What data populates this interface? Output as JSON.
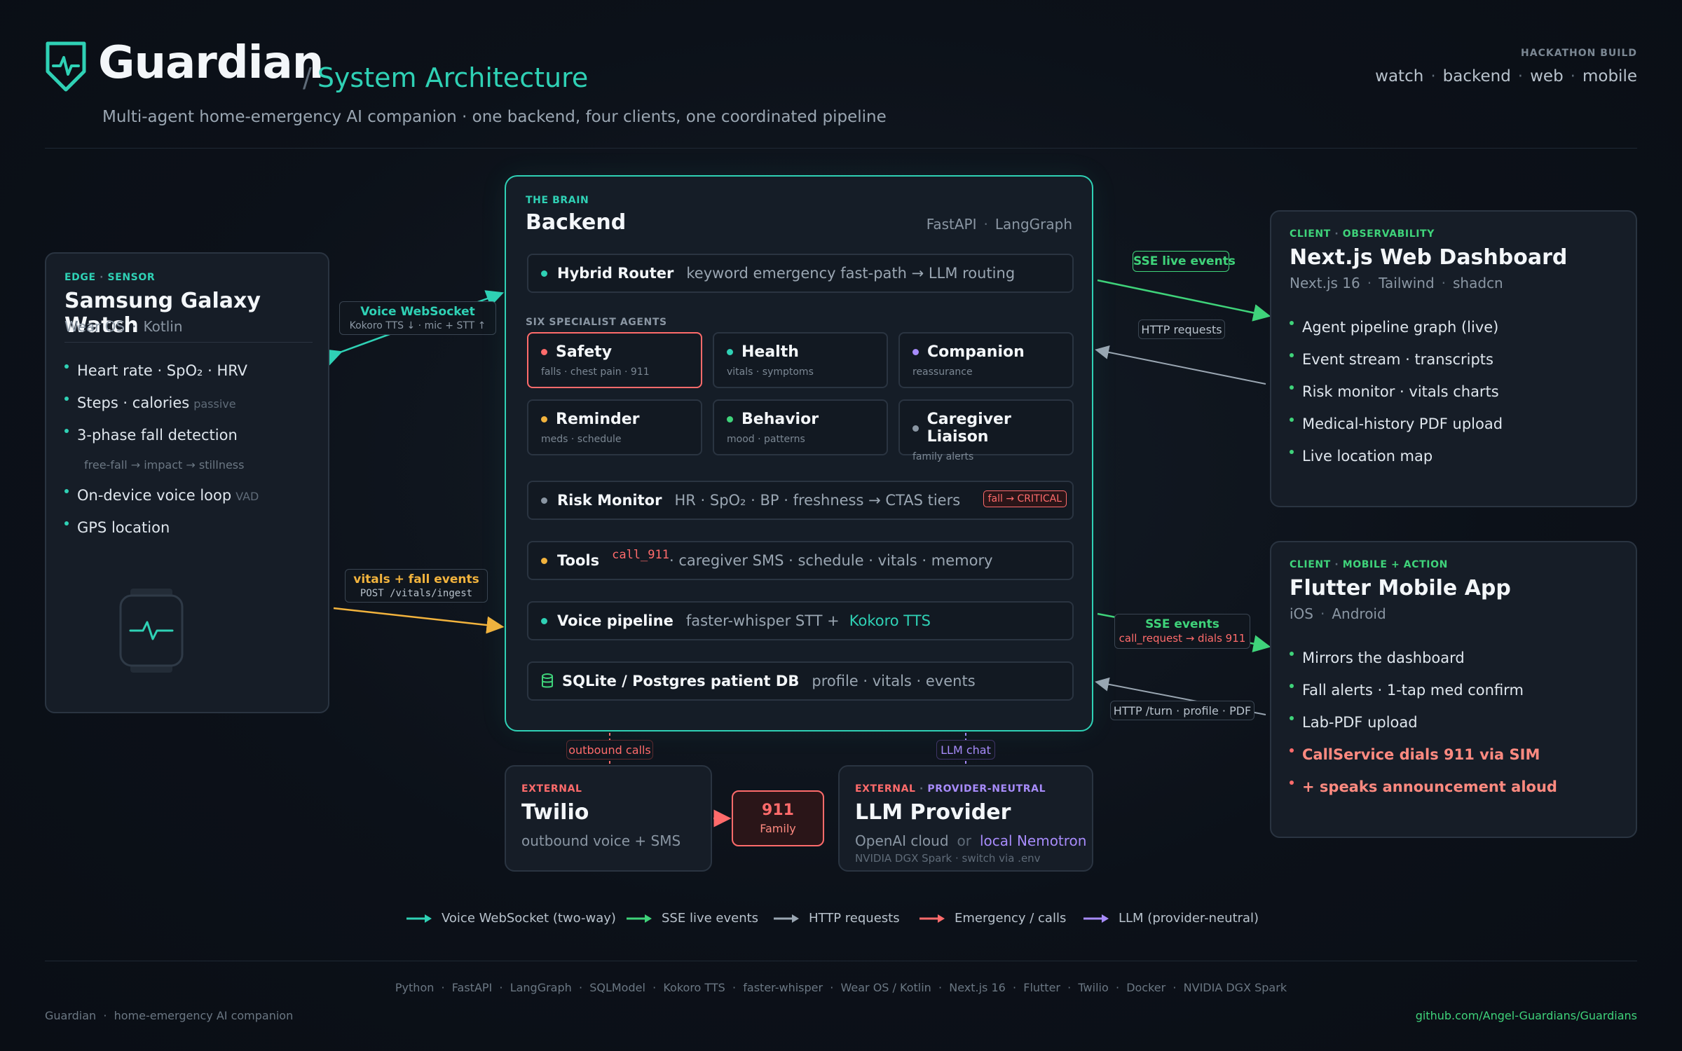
{
  "header": {
    "title": "Guardian",
    "slash": "/",
    "subtitle": "System Architecture",
    "tagline": "Multi-agent home-emergency AI companion  ·  one backend, four clients, one coordinated pipeline",
    "build_label": "HACKATHON BUILD",
    "targets": [
      "watch",
      "backend",
      "web",
      "mobile"
    ]
  },
  "watch": {
    "kicker_a": "EDGE",
    "kicker_b": "SENSOR",
    "title": "Samsung Galaxy Watch",
    "sub_a": "Wear OS",
    "sub_b": "Kotlin",
    "items": [
      {
        "text": "Heart rate · SpO₂ · HRV",
        "note": ""
      },
      {
        "text": "Steps · calories",
        "note": "passive"
      },
      {
        "text": "3-phase fall detection",
        "note": ""
      },
      {
        "text": "On-device voice loop",
        "note": "VAD"
      },
      {
        "text": "GPS location",
        "note": ""
      }
    ],
    "fall_phases": "free-fall → impact → stillness",
    "icon": "smartwatch-icon"
  },
  "backend": {
    "kicker": "THE BRAIN",
    "title": "Backend",
    "stack_a": "FastAPI",
    "stack_b": "LangGraph",
    "router": {
      "name": "Hybrid Router",
      "desc": "keyword emergency fast-path  →  LLM routing"
    },
    "agents_label": "SIX SPECIALIST AGENTS",
    "agents": [
      {
        "name": "Safety",
        "desc": "falls · chest pain · 911"
      },
      {
        "name": "Health",
        "desc": "vitals · symptoms"
      },
      {
        "name": "Companion",
        "desc": "reassurance"
      },
      {
        "name": "Reminder",
        "desc": "meds · schedule"
      },
      {
        "name": "Behavior",
        "desc": "mood · patterns"
      },
      {
        "name": "Caregiver Liaison",
        "desc": "family alerts"
      }
    ],
    "risk": {
      "name": "Risk Monitor",
      "desc": "HR · SpO₂ · BP · freshness  →  CTAS tiers",
      "badge": "fall → CRITICAL"
    },
    "tools": {
      "name": "Tools",
      "code": "call_911",
      "desc": " ·  caregiver SMS  ·  schedule  ·  vitals  ·  memory"
    },
    "voice": {
      "name": "Voice pipeline",
      "desc": "faster-whisper STT   +",
      "tts": "Kokoro TTS"
    },
    "db": {
      "name": "SQLite / Postgres patient DB",
      "desc": "profile · vitals · events"
    }
  },
  "web": {
    "kicker_a": "CLIENT",
    "kicker_b": "OBSERVABILITY",
    "title": "Next.js Web Dashboard",
    "sub": [
      "Next.js 16",
      "Tailwind",
      "shadcn"
    ],
    "items": [
      "Agent pipeline graph (live)",
      "Event stream · transcripts",
      "Risk monitor · vitals charts",
      "Medical-history PDF upload",
      "Live location map"
    ]
  },
  "mobile": {
    "kicker_a": "CLIENT",
    "kicker_b": "MOBILE + ACTION",
    "title": "Flutter Mobile App",
    "sub": [
      "iOS",
      "Android"
    ],
    "items": [
      "Mirrors the dashboard",
      "Fall alerts · 1-tap med confirm",
      "Lab-PDF upload"
    ],
    "alert_items": [
      "CallService dials 911 via SIM",
      "+ speaks announcement aloud"
    ]
  },
  "twilio": {
    "kicker": "EXTERNAL",
    "title": "Twilio",
    "sub": "outbound voice + SMS",
    "target_a": "911",
    "target_b": "Family"
  },
  "llm": {
    "kicker_a": "EXTERNAL",
    "kicker_b": "PROVIDER-NEUTRAL",
    "title": "LLM Provider",
    "opt_a": "OpenAI cloud",
    "or": "or",
    "opt_b": "local Nemotron",
    "note": "NVIDIA DGX Spark  ·  switch via .env"
  },
  "edges": {
    "voice_ws": "Voice WebSocket",
    "voice_ws_sub": "Kokoro TTS ↓  ·  mic + STT ↑",
    "vitals": "vitals + fall events",
    "vitals_sub": "POST /vitals/ingest",
    "sse": "SSE live events",
    "http": "HTTP requests",
    "sse2": "SSE events",
    "sse2_sub": "call_request → dials 911",
    "http2": "HTTP  /turn · profile · PDF",
    "outbound": "outbound calls",
    "llm_chat": "LLM chat"
  },
  "legend": [
    {
      "label": "Voice WebSocket (two-way)",
      "color": "#2fd1b5"
    },
    {
      "label": "SSE live events",
      "color": "#3fd37a"
    },
    {
      "label": "HTTP requests",
      "color": "#9aa6b2"
    },
    {
      "label": "Emergency / calls",
      "color": "#ff6b6b"
    },
    {
      "label": "LLM (provider-neutral)",
      "color": "#a78bfa"
    }
  ],
  "footer": {
    "stack": "Python  ·  FastAPI  ·  LangGraph  ·  SQLModel  ·  Kokoro TTS  ·  faster-whisper  ·  Wear OS / Kotlin  ·  Next.js 16  ·  Flutter  ·  Twilio  ·  Docker  ·  NVIDIA DGX Spark",
    "left": "Guardian  ·  home-emergency AI companion",
    "right": "github.com/Angel-Guardians/Guardians"
  }
}
